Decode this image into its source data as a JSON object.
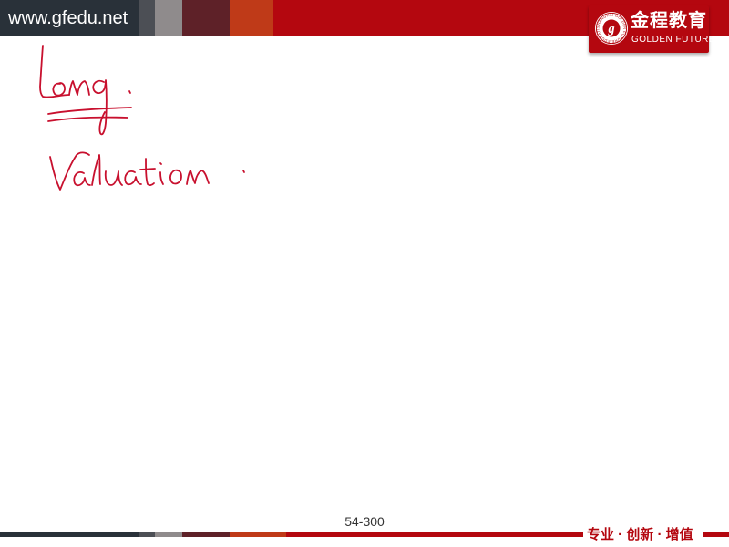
{
  "header": {
    "site_url": "www.gfedu.net"
  },
  "logo": {
    "name_cn": "金程教育",
    "name_en": "GOLDEN FUTURE",
    "icon": "gf-seal-logo",
    "seal_text": "SHANGHAI GOLDEN FUTURE EDUCATION · 1995",
    "seal_letter": "g"
  },
  "notes": {
    "line1": "Long",
    "line2": "Valuation."
  },
  "footer": {
    "page_number": "54-300",
    "slogan": "专业 · 创新 · 增值"
  },
  "colors": {
    "brand_red": "#b4070f",
    "dark_slate": "#293139",
    "ink_red": "#c8102e"
  }
}
